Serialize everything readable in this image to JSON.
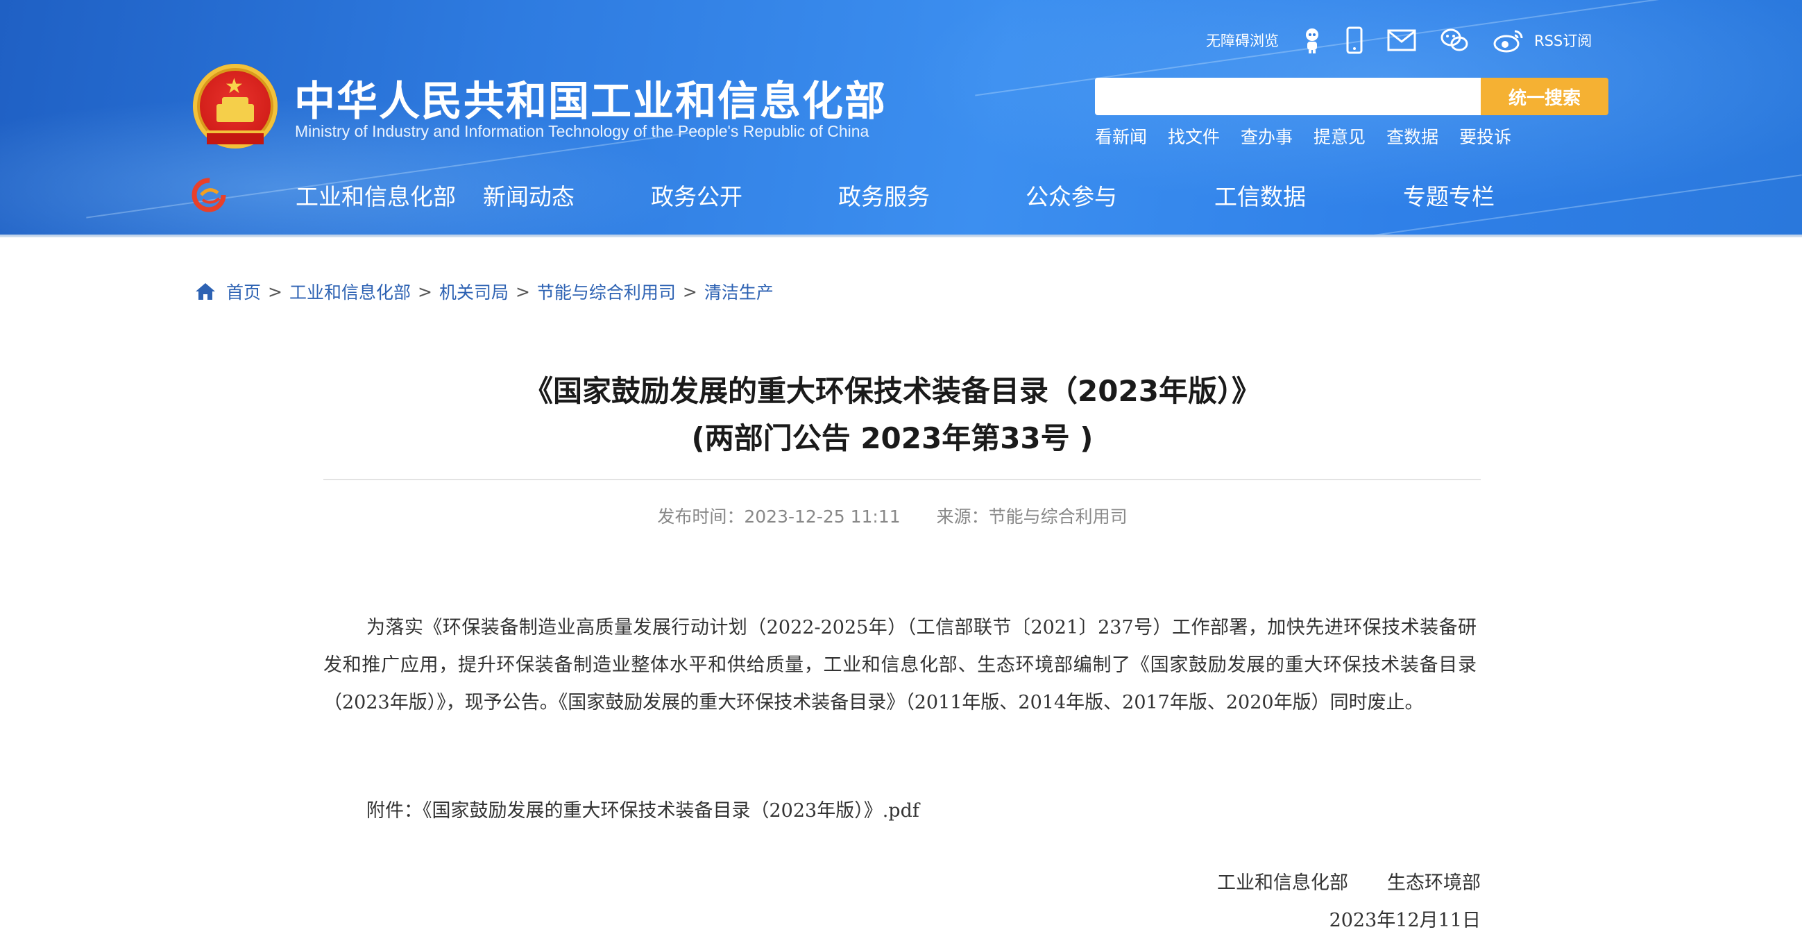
{
  "header": {
    "title": "中华人民共和国工业和信息化部",
    "subtitle": "Ministry of Industry and Information Technology of the People's Republic of China",
    "toplinks": {
      "accessibility": "无障碍浏览",
      "rss": "RSS订阅"
    },
    "search": {
      "placeholder": "",
      "button": "统一搜索"
    },
    "quicklinks": [
      "看新闻",
      "找文件",
      "查办事",
      "提意见",
      "查数据",
      "要投诉"
    ],
    "nav": [
      "工业和信息化部",
      "新闻动态",
      "政务公开",
      "政务服务",
      "公众参与",
      "工信数据",
      "专题专栏"
    ],
    "colors": {
      "header_blue": "#2e7be0",
      "search_button": "#f5b133",
      "link_blue": "#2d62b3"
    }
  },
  "breadcrumb": [
    "首页",
    "工业和信息化部",
    "机关司局",
    "节能与综合利用司",
    "清洁生产"
  ],
  "article": {
    "title_line1": "《国家鼓励发展的重大环保技术装备目录（2023年版）》",
    "title_line2": "(两部门公告 2023年第33号 )",
    "publish_time": "发布时间：2023-12-25 11:11",
    "source": "来源：节能与综合利用司",
    "paragraph1": "为落实《环保装备制造业高质量发展行动计划（2022-2025年）（工信部联节〔2021〕237号）工作部署，加快先进环保技术装备研发和推广应用，提升环保装备制造业整体水平和供给质量，工业和信息化部、生态环境部编制了《国家鼓励发展的重大环保技术装备目录（2023年版）》，现予公告。《国家鼓励发展的重大环保技术装备目录》（2011年版、2014年版、2017年版、2020年版）同时废止。",
    "attachment_label": "附件：",
    "attachment_link": "《国家鼓励发展的重大环保技术装备目录（2023年版）》.pdf",
    "signer1": "工业和信息化部",
    "signer2": "生态环境部",
    "date": "2023年12月11日"
  }
}
